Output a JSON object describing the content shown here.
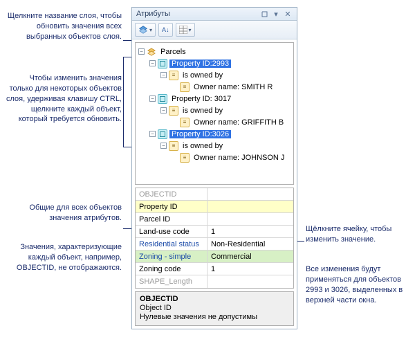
{
  "annotations": {
    "a1": "Щелкните название слоя, чтобы обновить значения всех выбранных объектов слоя.",
    "a2": "Чтобы изменить значения только для некоторых объектов слоя, удерживая клавишу CTRL, щелкните каждый объект, который требуется обновить.",
    "a3": "Общие для всех объектов значения атрибутов.",
    "a4": "Значения, характеризующие каждый объект, например, OBJECTID, не отображаются.",
    "a5": "Щёлкните ячейку, чтобы изменить значение.",
    "a6": "Все изменения будут применяться для объектов 2993 и 3026, выделенных в верхней части окна."
  },
  "window": {
    "title": "Атрибуты"
  },
  "tree": {
    "root": "Parcels",
    "n1": {
      "label": "Property ID:2993",
      "rel": "is owned by",
      "owner": "Owner name: SMITH R"
    },
    "n2": {
      "label": "Property ID: 3017",
      "rel": "is owned by",
      "owner": "Owner name: GRIFFITH B"
    },
    "n3": {
      "label": "Property ID:3026",
      "rel": "is owned by",
      "owner": "Owner name: JOHNSON J"
    }
  },
  "grid": {
    "rows": {
      "r0": {
        "name": "OBJECTID",
        "value": ""
      },
      "r1": {
        "name": "Property ID",
        "value": ""
      },
      "r2": {
        "name": "Parcel ID",
        "value": ""
      },
      "r3": {
        "name": "Land-use code",
        "value": "1"
      },
      "r4": {
        "name": "Residential status",
        "value": "Non-Residential"
      },
      "r5": {
        "name": "Zoning - simple",
        "value": "Commercial"
      },
      "r6": {
        "name": "Zoning code",
        "value": "1"
      },
      "r7": {
        "name": "SHAPE_Length",
        "value": ""
      }
    }
  },
  "desc": {
    "title": "OBJECTID",
    "sub": "Object ID",
    "note": "Нулевые значения не допустимы"
  }
}
